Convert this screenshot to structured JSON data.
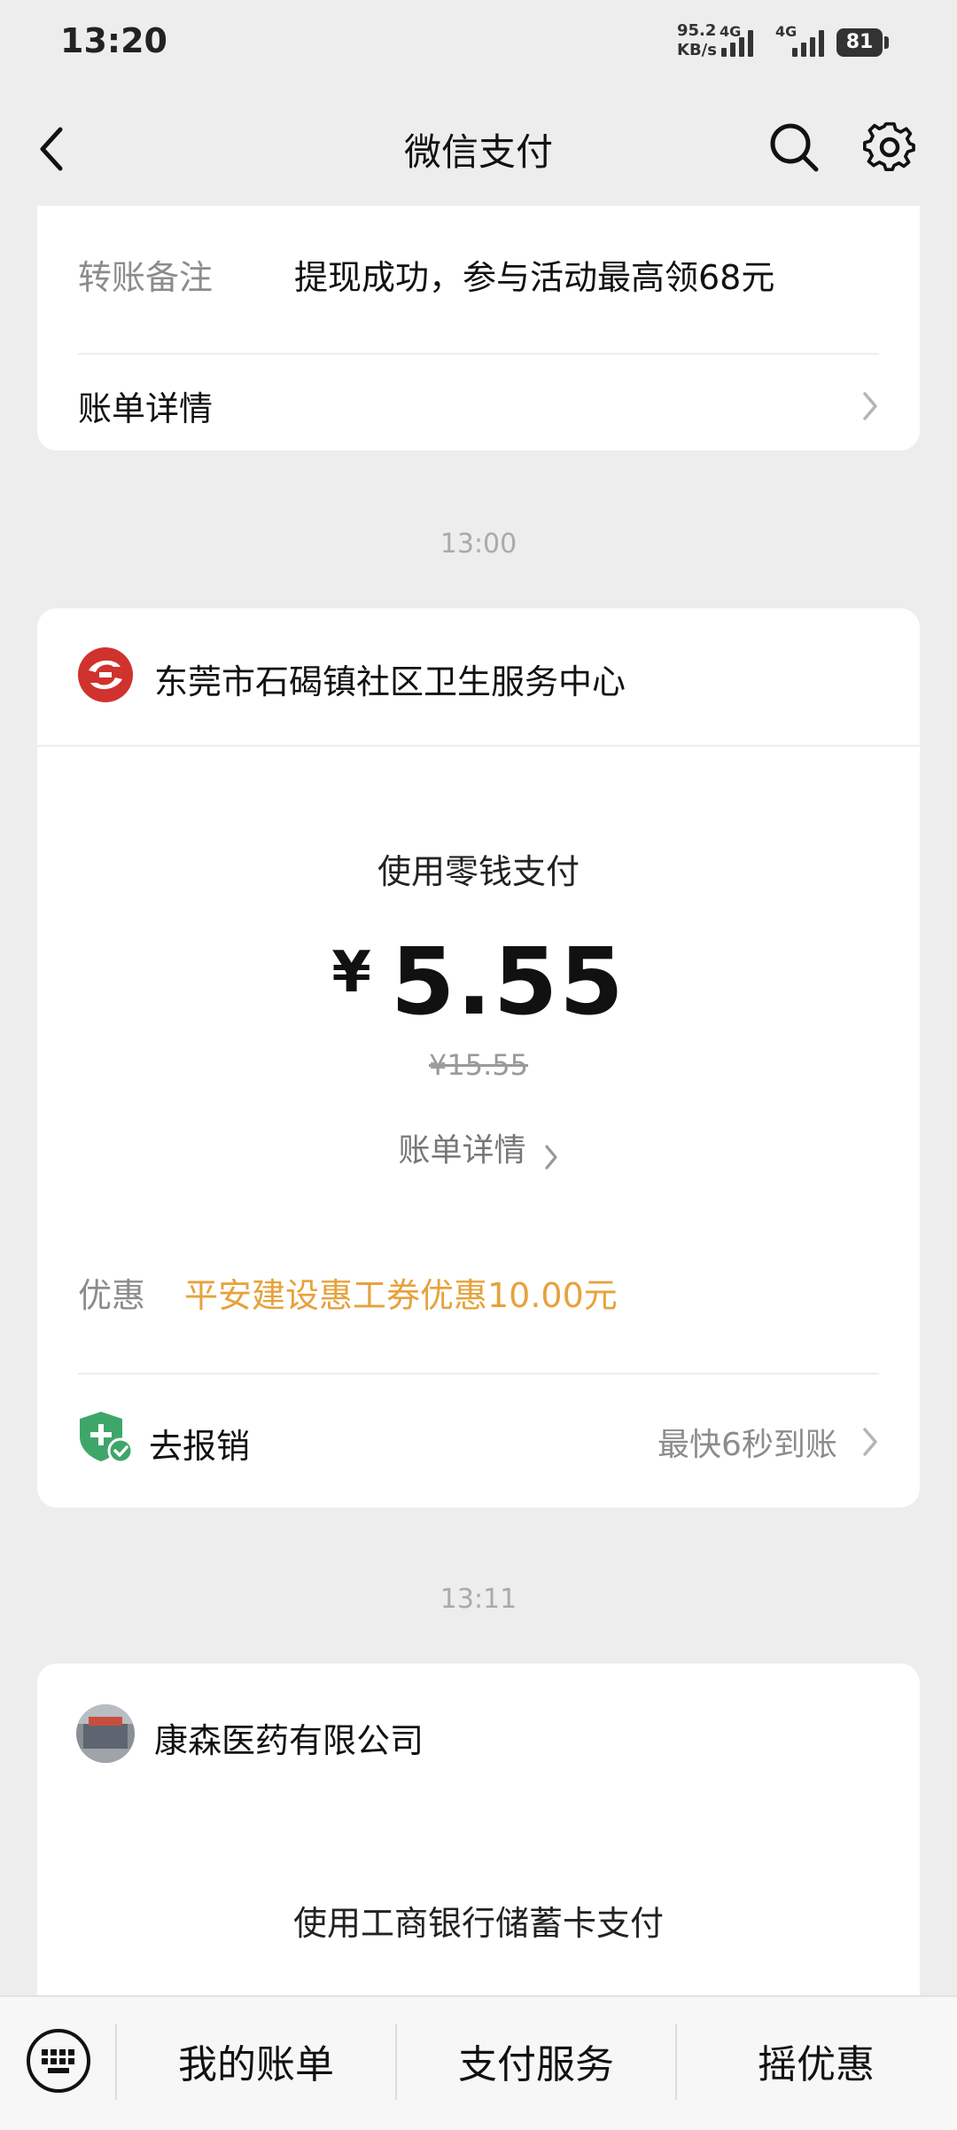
{
  "status_bar": {
    "time": "13:20",
    "net_speed_value": "95.2",
    "net_speed_unit": "KB/s",
    "net_type_1": "4G",
    "net_type_2": "4G",
    "battery": "81"
  },
  "nav": {
    "title": "微信支付",
    "back_icon": "chevron-left-icon",
    "search_icon": "search-icon",
    "settings_icon": "gear-icon"
  },
  "card_transfer": {
    "note_label": "转账备注",
    "note_value": "提现成功，参与活动最高领68元",
    "detail_label": "账单详情"
  },
  "timestamp_1": "13:00",
  "card_payment_1": {
    "merchant_name": "东莞市石碣镇社区卫生服务中心",
    "method": "使用零钱支付",
    "currency_symbol": "¥",
    "amount": "5.55",
    "original_amount": "¥15.55",
    "detail_link": "账单详情",
    "discount_label": "优惠",
    "discount_value": "平安建设惠工券优惠10.00元",
    "reimburse_label": "去报销",
    "reimburse_hint": "最快6秒到账",
    "accent_color": "#e6a23c"
  },
  "timestamp_2": "13:11",
  "card_payment_2": {
    "merchant_name": "康森医药有限公司",
    "method": "使用工商银行储蓄卡支付"
  },
  "bottom_bar": {
    "keyboard_icon": "keyboard-icon",
    "tabs": [
      "我的账单",
      "支付服务",
      "摇优惠"
    ]
  }
}
